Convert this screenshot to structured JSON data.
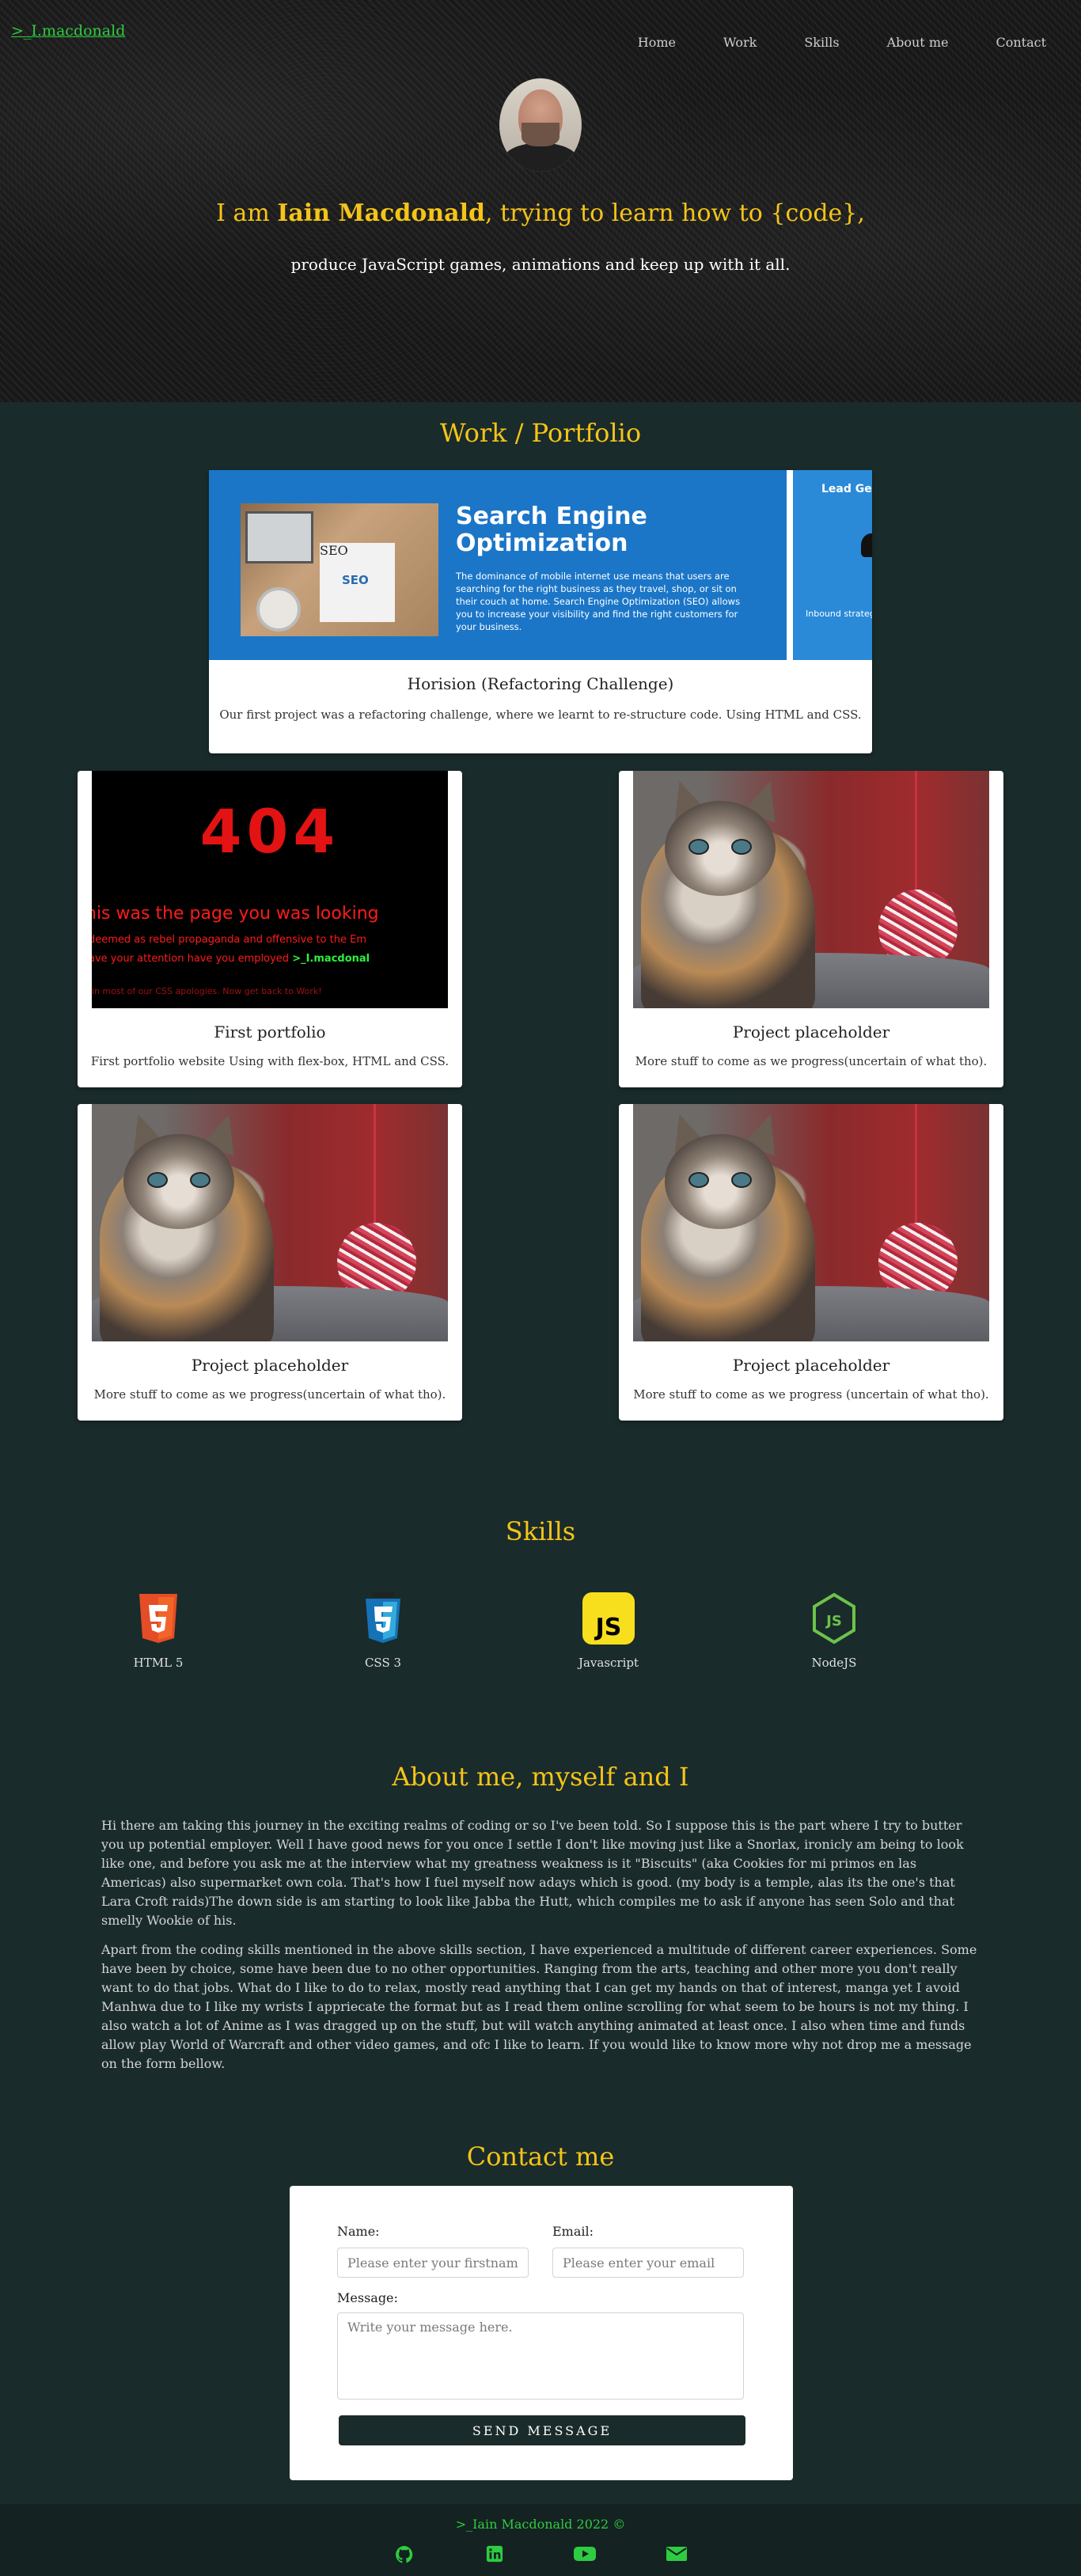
{
  "header": {
    "brand": ">_I.macdonald",
    "nav": [
      "Home",
      "Work",
      "Skills",
      "About me",
      "Contact"
    ],
    "hero_prefix": "I am ",
    "hero_name": "Iain Macdonald",
    "hero_suffix": ", trying to learn how to {code},",
    "hero_sub": "produce JavaScript games, animations and keep up with it all."
  },
  "work": {
    "title": "Work / Portfolio",
    "featured": {
      "title": "Horision (Refactoring Challenge)",
      "desc": "Our first project was a refactoring challenge, where we learnt to re-structure code. Using HTML and CSS.",
      "image_text": {
        "headline_1": "Search Engine",
        "headline_2": "Optimization",
        "body": "The dominance of mobile internet use means that users are searching for the right business as they travel, shop, or sit on their couch at home. Search Engine Optimization (SEO) allows you to increase your visibility and find the right customers for your business.",
        "side_title": "Lead Gen",
        "side_body": "Inbound strateg generation requ for your busines customers dire",
        "pad_label": "SEO"
      }
    },
    "cards": [
      {
        "title": "First portfolio",
        "desc": "First portfolio website Using with flex-box, HTML and CSS.",
        "image": "404",
        "image_text": {
          "num": "404",
          "line1": "his was the page you was looking",
          "line2": "deemed as rebel propaganda and offensive to the Em",
          "line3_prefix": "ave your attention have you employed ",
          "line3_brand": ">_I.macdonal",
          "line4": "in most of our CSS apologies. Now get back to Work!"
        }
      },
      {
        "title": "Project placeholder",
        "desc": "More stuff to come as we progress(uncertain of what tho).",
        "image": "kitten"
      },
      {
        "title": "Project placeholder",
        "desc": "More stuff to come as we progress(uncertain of what tho).",
        "image": "kitten"
      },
      {
        "title": "Project placeholder",
        "desc": "More stuff to come as we progress (uncertain of what tho).",
        "image": "kitten"
      }
    ]
  },
  "skills": {
    "title": "Skills",
    "items": [
      {
        "label": "HTML 5",
        "icon": "html5-icon",
        "color": "#e44d26",
        "mark": "5"
      },
      {
        "label": "CSS 3",
        "icon": "css3-icon",
        "color": "#1572b6",
        "mark": "3"
      },
      {
        "label": "Javascript",
        "icon": "javascript-icon",
        "color": "#f7df1e",
        "mark": "JS"
      },
      {
        "label": "NodeJS",
        "icon": "nodejs-icon",
        "color": "#6cc24a",
        "mark": "JS"
      }
    ]
  },
  "about": {
    "title": "About me, myself and I",
    "p1": "Hi there am taking this journey in the exciting realms of coding or so I've been told. So I suppose this is the part where I try to butter you up potential employer. Well I have good news for you once I settle I don't like moving just like a Snorlax, ironicly am being to look like one, and before you ask me at the interview what my greatness weakness is it \"Biscuits\" (aka Cookies for mi primos en las Americas) also supermarket own cola. That's how I fuel myself now adays which is good. (my body is a temple, alas its the one's that Lara Croft raids)The down side is am starting to look like Jabba the Hutt, which compiles me to ask if anyone has seen Solo and that smelly Wookie of his.",
    "p2": "Apart from the coding skills mentioned in the above skills section, I have experienced a multitude of different career experiences. Some have been by choice, some have been due to no other opportunities. Ranging from the arts, teaching and other more you don't really want to do that jobs. What do I like to do to relax, mostly read anything that I can get my hands on that of interest, manga yet I avoid Manhwa due to I like my wrists I appriecate the format but as I read them online scrolling for what seem to be hours is not my thing. I also watch a lot of Anime as I was dragged up on the stuff, but will watch anything animated at least once. I also when time and funds allow play World of Warcraft and other video games, and ofc I like to learn. If you would like to know more why not drop me a message on the form bellow."
  },
  "contact": {
    "title": "Contact me",
    "name_label": "Name:",
    "name_placeholder": "Please enter your firstname",
    "email_label": "Email:",
    "email_placeholder": "Please enter your email",
    "message_label": "Message:",
    "message_placeholder": "Write your message here.",
    "send_label": "SEND MESSAGE"
  },
  "footer": {
    "copy": ">_Iain Macdonald 2022 ©",
    "icons": [
      "github-icon",
      "linkedin-icon",
      "youtube-icon",
      "email-icon"
    ],
    "icon_color": "#2ecc40"
  },
  "colors": {
    "accent": "#f4c418",
    "brand_green": "#2ecc40",
    "background": "#1a2b2b"
  }
}
